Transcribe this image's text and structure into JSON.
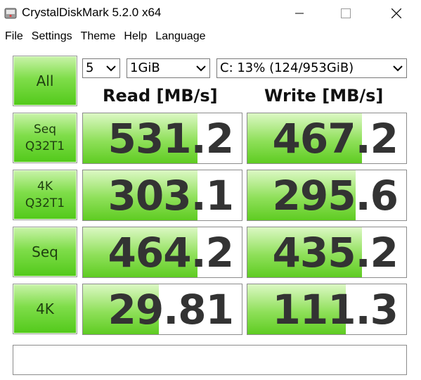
{
  "window": {
    "title": "CrystalDiskMark 5.2.0 x64",
    "icon": "crystaldiskmark-app-icon"
  },
  "menu": [
    "File",
    "Settings",
    "Theme",
    "Help",
    "Language"
  ],
  "controls": {
    "all_label": "All",
    "count_value": "5",
    "size_value": "1GiB",
    "drive_value": "C: 13% (124/953GiB)"
  },
  "headers": {
    "read": "Read [MB/s]",
    "write": "Write [MB/s]"
  },
  "tests": [
    {
      "label_line1": "Seq",
      "label_line2": "Q32T1",
      "read": "531.2",
      "write": "467.2",
      "read_fill": 0.72,
      "write_fill": 0.72
    },
    {
      "label_line1": "4K",
      "label_line2": "Q32T1",
      "read": "303.1",
      "write": "295.6",
      "read_fill": 0.72,
      "write_fill": 0.68
    },
    {
      "label_line1": "Seq",
      "label_line2": "",
      "read": "464.2",
      "write": "435.2",
      "read_fill": 0.72,
      "write_fill": 0.72
    },
    {
      "label_line1": "4K",
      "label_line2": "",
      "read": "29.81",
      "write": "111.3",
      "read_fill": 0.48,
      "write_fill": 0.62
    }
  ],
  "status_text": "",
  "colors": {
    "button_green": "#52c91a",
    "fill_green": "#5fcc22",
    "value_text": "#333333"
  }
}
